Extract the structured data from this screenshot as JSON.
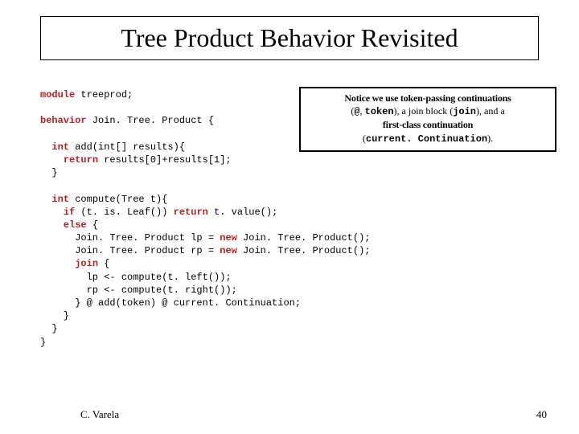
{
  "title": "Tree Product Behavior Revisited",
  "notice": {
    "line1": "Notice we use token-passing continuations",
    "line2_pre": "(",
    "line2_at": "@",
    "line2_mid1": ", ",
    "line2_token": "token",
    "line2_mid2": "), a join block (",
    "line2_join": "join",
    "line2_mid3": "), and a",
    "line3": "first-class continuation",
    "line4_open": "(",
    "line4_cont": "current. Continuation",
    "line4_close": ")."
  },
  "code": {
    "kw_module": "module",
    "module_name": " treeprod;",
    "kw_behavior": "behavior",
    "behavior_name": " Join. Tree. Product {",
    "kw_int1": "int",
    "add_sig": " add(int[] results){",
    "kw_return1": "return",
    "add_ret": " results[0]+results[1];",
    "close1": "}",
    "kw_int2": "int",
    "compute_sig": " compute(Tree t){",
    "kw_if": "if",
    "if_cond": " (t. is. Leaf()) ",
    "kw_return2": "return",
    "if_ret": " t. value();",
    "kw_else": "else",
    "else_open": " {",
    "lp_line": "      Join. Tree. Product lp = ",
    "kw_new1": "new",
    "lp_tail": " Join. Tree. Product();",
    "rp_line": "      Join. Tree. Product rp = ",
    "kw_new2": "new",
    "rp_tail": " Join. Tree. Product();",
    "kw_join": "join",
    "join_open": " {",
    "join_l1": "        lp <- compute(t. left());",
    "join_l2": "        rp <- compute(t. right());",
    "join_close": "      } @ add(token) @ current. Continuation;",
    "close_else": "    }",
    "close_compute": "  }",
    "close_behavior": "}"
  },
  "footer": {
    "author": "C. Varela",
    "page": "40"
  }
}
